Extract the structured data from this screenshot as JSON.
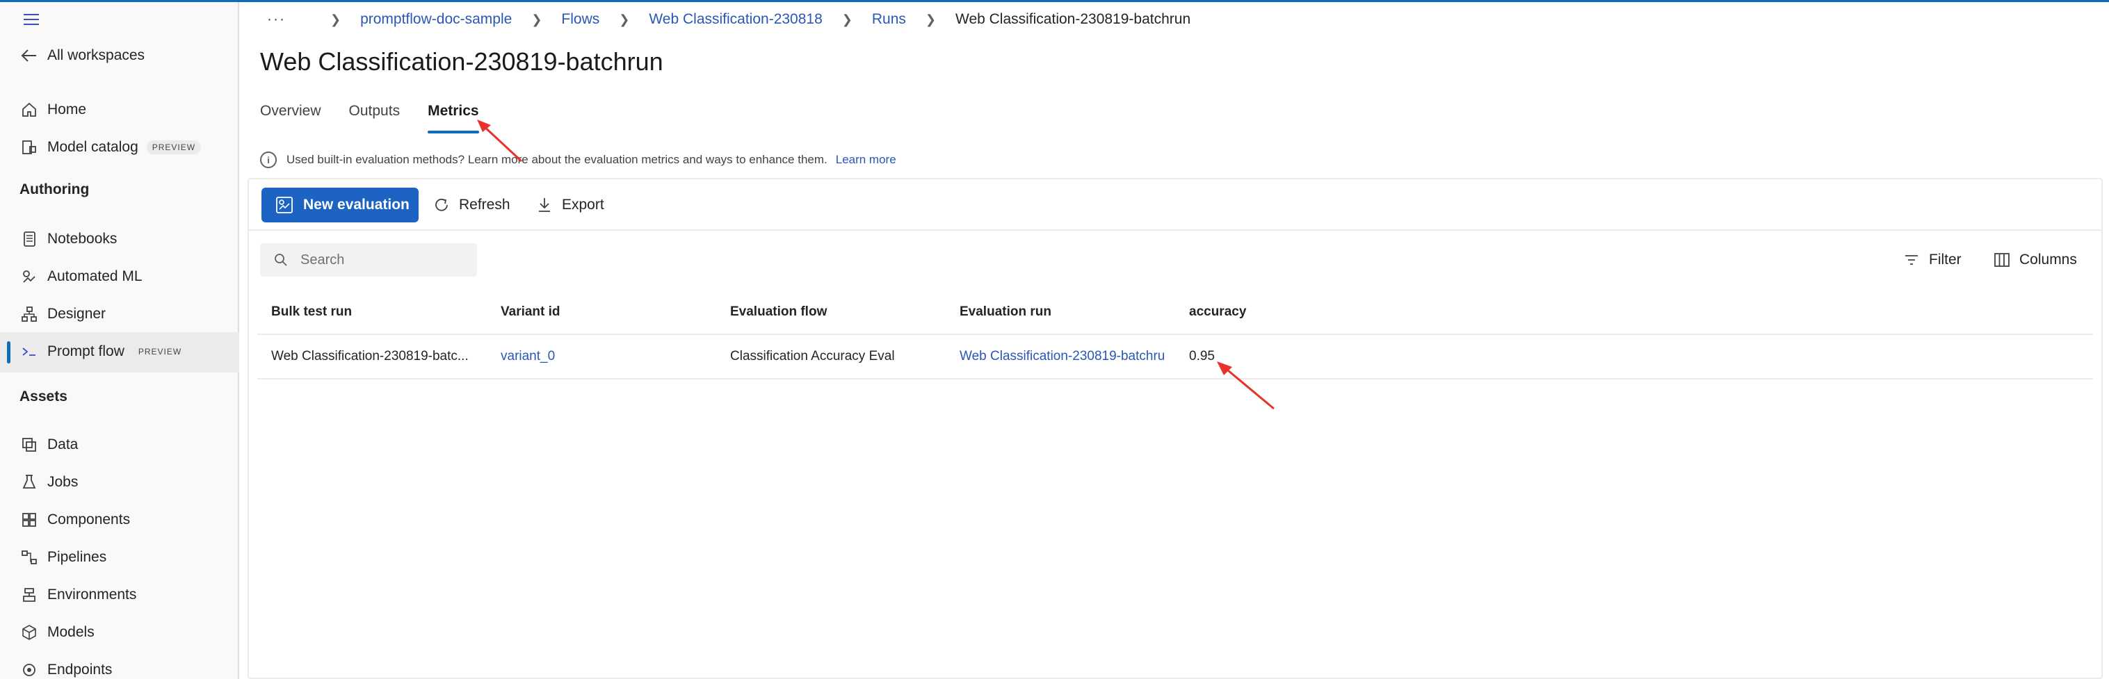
{
  "sidebar": {
    "all_workspaces": "All workspaces",
    "items_top": [
      {
        "label": "Home",
        "icon": "home-icon"
      },
      {
        "label": "Model catalog",
        "icon": "catalog-icon",
        "badge": "PREVIEW"
      }
    ],
    "section_authoring": "Authoring",
    "items_authoring": [
      {
        "label": "Notebooks",
        "icon": "notebook-icon"
      },
      {
        "label": "Automated ML",
        "icon": "automl-icon"
      },
      {
        "label": "Designer",
        "icon": "designer-icon"
      },
      {
        "label": "Prompt flow",
        "icon": "prompt-flow-icon",
        "badge": "PREVIEW",
        "active": true
      }
    ],
    "section_assets": "Assets",
    "items_assets": [
      {
        "label": "Data",
        "icon": "data-icon"
      },
      {
        "label": "Jobs",
        "icon": "jobs-icon"
      },
      {
        "label": "Components",
        "icon": "components-icon"
      },
      {
        "label": "Pipelines",
        "icon": "pipelines-icon"
      },
      {
        "label": "Environments",
        "icon": "environments-icon"
      },
      {
        "label": "Models",
        "icon": "models-icon"
      },
      {
        "label": "Endpoints",
        "icon": "endpoints-icon"
      }
    ]
  },
  "breadcrumb": {
    "more": "···",
    "items": [
      "promptflow-doc-sample",
      "Flows",
      "Web Classification-230818",
      "Runs"
    ],
    "current": "Web Classification-230819-batchrun"
  },
  "page_title": "Web Classification-230819-batchrun",
  "tabs": [
    {
      "label": "Overview",
      "active": false
    },
    {
      "label": "Outputs",
      "active": false
    },
    {
      "label": "Metrics",
      "active": true
    }
  ],
  "info": {
    "text": "Used built-in evaluation methods? Learn more about the evaluation metrics and ways to enhance them.",
    "link": "Learn more"
  },
  "toolbar": {
    "new_evaluation": "New evaluation",
    "refresh": "Refresh",
    "export": "Export",
    "filter": "Filter",
    "columns": "Columns"
  },
  "search": {
    "placeholder": "Search",
    "value": ""
  },
  "table": {
    "headers": [
      "Bulk test run",
      "Variant id",
      "Evaluation flow",
      "Evaluation run",
      "accuracy"
    ],
    "rows": [
      {
        "bulk_test_run": "Web Classification-230819-batc...",
        "variant_id": "variant_0",
        "evaluation_flow": "Classification Accuracy Eval",
        "evaluation_run": "Web Classification-230819-batchru",
        "accuracy": "0.95"
      }
    ]
  },
  "colors": {
    "accent": "#0f6cbd",
    "primary_button": "#1d63c4",
    "link": "#2a56b8",
    "annotation_arrow": "#e8322b"
  }
}
